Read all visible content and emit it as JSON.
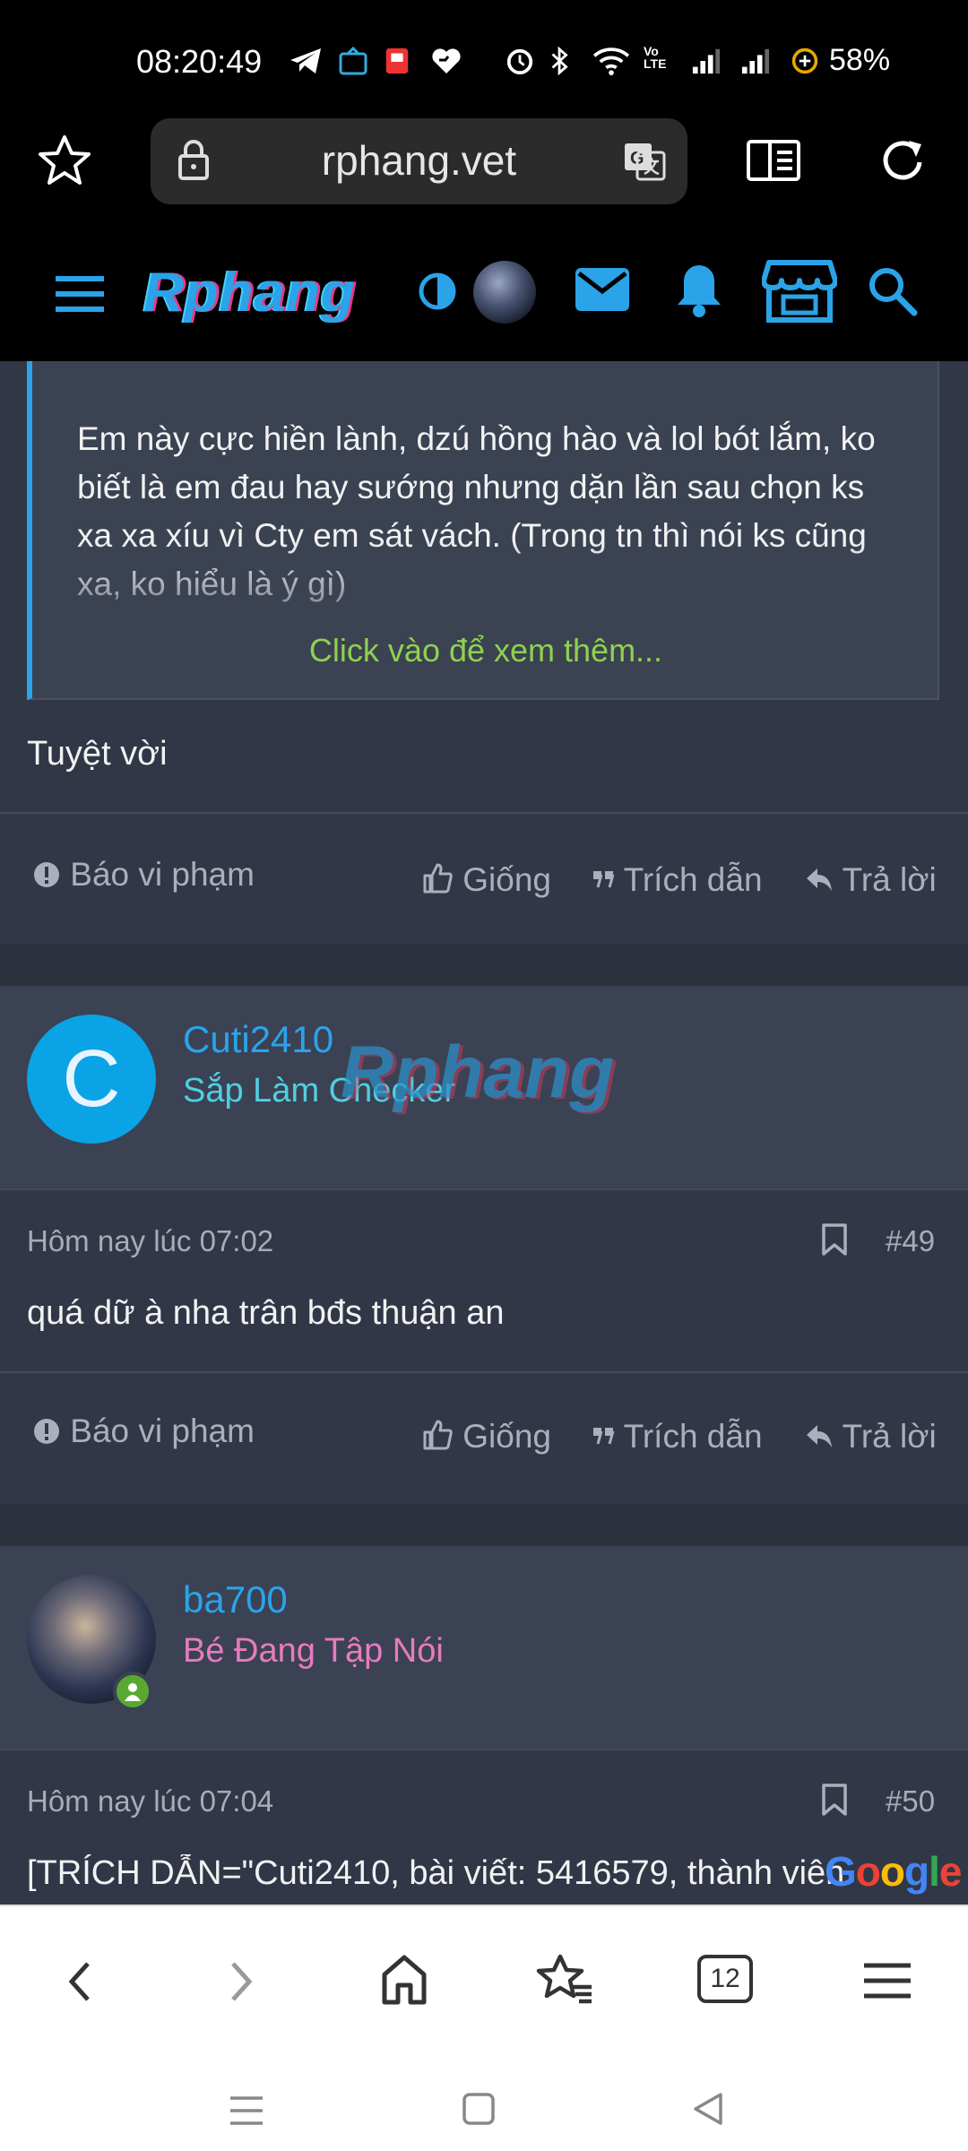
{
  "status_bar": {
    "time": "08:20:49",
    "battery": "58%",
    "icons": [
      "telegram-icon",
      "tiktok-icon",
      "shopee-pay-icon",
      "heart-icon",
      "alarm-icon",
      "bluetooth-icon",
      "wifi-icon",
      "volte-icon",
      "signal-icon",
      "signal-icon",
      "battery-saver-icon"
    ]
  },
  "browser": {
    "url": "rphang.vet",
    "tab_count": "12"
  },
  "site": {
    "logo_text": "Rphang"
  },
  "quote": {
    "text": "Em này cực hiền lành, dzú hồng hào và lol bót lắm, ko biết là em đau hay sướng nhưng dặn lần sau chọn ks xa xa xíu vì Cty em sát vách. (Trong tn thì nói ks cũng xa, ko hiểu là ý gì)",
    "expand": "Click vào để xem thêm..."
  },
  "post48": {
    "body": "Tuyệt vời",
    "report": "Báo vi phạm",
    "like": "Giống",
    "quote": "Trích dẫn",
    "reply": "Trả lời"
  },
  "post49": {
    "avatar_letter": "C",
    "username": "Cuti2410",
    "rank": "Sắp Làm Checker",
    "time": "Hôm nay lúc 07:02",
    "number": "#49",
    "body": "quá dữ à nha trân bđs thuận an",
    "report": "Báo vi phạm",
    "like": "Giống",
    "quote": "Trích dẫn",
    "reply": "Trả lời"
  },
  "post50": {
    "username": "ba700",
    "rank": "Bé Đang Tập Nói",
    "time": "Hôm nay lúc 07:04",
    "number": "#50",
    "body": "[TRÍCH DẪN=\"Cuti2410, bài viết: 5416579, thành viên"
  },
  "watermark": "Rphang",
  "google_badge": "Google",
  "colors": {
    "accent_blue": "#2ba3e8",
    "link_green": "#8fd14f",
    "rank_pink": "#e87bbf",
    "rank_cyan": "#4fd0e0"
  }
}
